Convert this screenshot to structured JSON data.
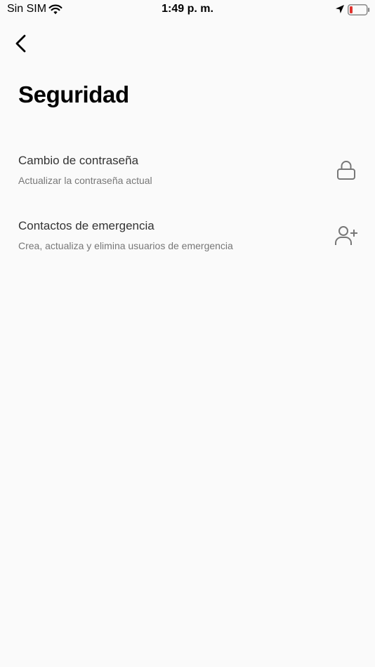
{
  "status_bar": {
    "carrier": "Sin SIM",
    "time": "1:49 p. m.",
    "icons": [
      "wifi-icon",
      "location-arrow-icon",
      "battery-low-icon"
    ],
    "battery_color": "#e0322d"
  },
  "header": {
    "back_icon": "chevron-left-icon",
    "title": "Seguridad"
  },
  "settings": {
    "items": [
      {
        "title": "Cambio de contraseña",
        "subtitle": "Actualizar la contraseña actual",
        "icon": "lock-icon"
      },
      {
        "title": "Contactos de emergencia",
        "subtitle": "Crea, actualiza y elimina usuarios de emergencia",
        "icon": "user-plus-icon"
      }
    ]
  },
  "colors": {
    "background": "#fafafa",
    "title": "#000000",
    "item_title": "#333333",
    "item_subtitle": "#777777",
    "icon": "#777777"
  }
}
